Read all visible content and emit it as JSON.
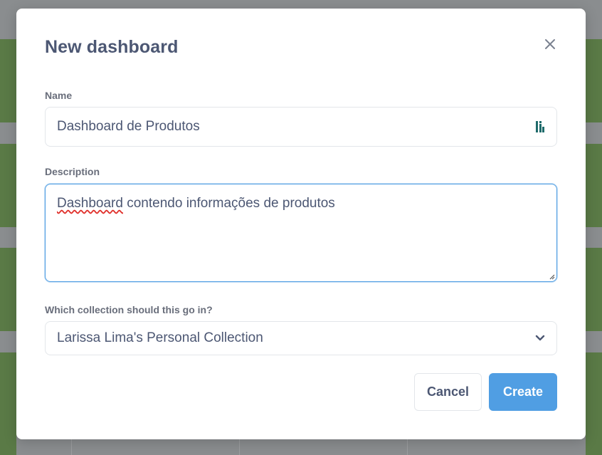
{
  "modal": {
    "title": "New dashboard",
    "close_icon": "close-icon"
  },
  "name_field": {
    "label": "Name",
    "value": "Dashboard de Produtos",
    "icon": "password-manager-icon",
    "icon_color": "#1f6b6b"
  },
  "description_field": {
    "label": "Description",
    "value_misspelled": "Dashboard",
    "value_rest": " contendo informações de produtos",
    "focus_color": "#509ee3"
  },
  "collection_field": {
    "label": "Which collection should this go in?",
    "value": "Larissa Lima's Personal Collection",
    "icon": "chevron-down-icon"
  },
  "buttons": {
    "cancel_label": "Cancel",
    "create_label": "Create",
    "primary_color": "#509ee3"
  }
}
